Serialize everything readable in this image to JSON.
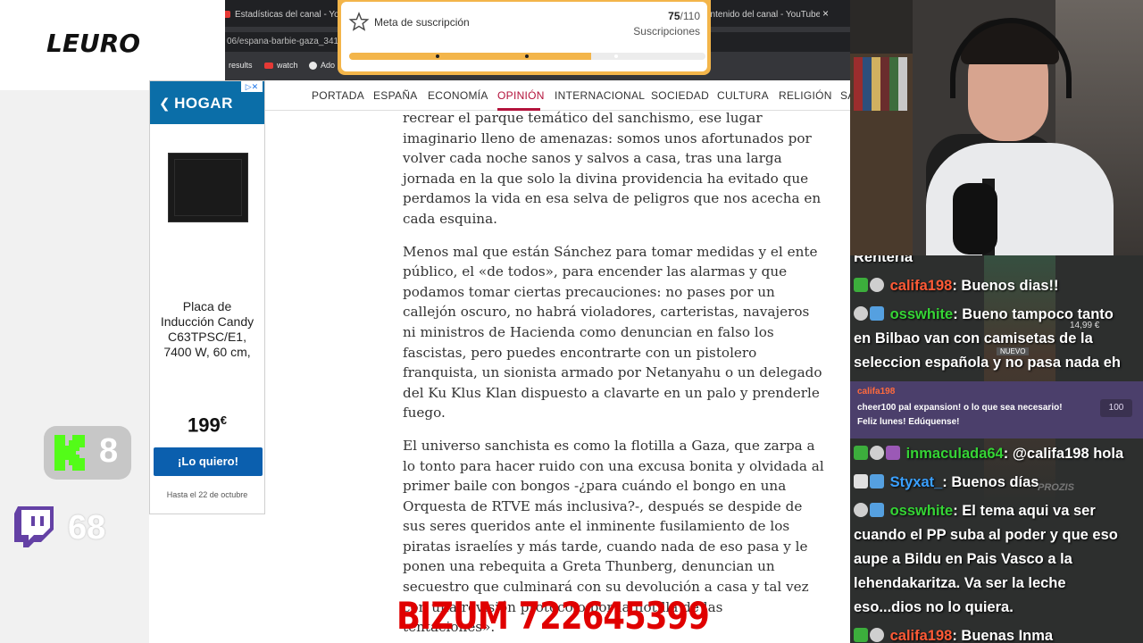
{
  "browser": {
    "tabs": [
      {
        "label": "Estadísticas del canal - YouTub"
      },
      {
        "label": "ontenido del canal - YouTube"
      }
    ],
    "tab_close": "×",
    "address_fragment": "06/espana-barbie-gaza_341",
    "bookmarks": [
      {
        "label": "results",
        "icon": "google-icon"
      },
      {
        "label": "watch",
        "icon": "youtube-icon"
      },
      {
        "label": "Ado",
        "icon": "bookmark-icon"
      }
    ]
  },
  "overlay": {
    "logo": "LEURO",
    "subscription_goal": {
      "title": "Meta de suscripción",
      "current": "75",
      "target": "/110",
      "unit": "Suscripciones",
      "progress_fraction": 0.68,
      "color": "#f3b54a"
    },
    "kick": {
      "count": "8",
      "color": "#53fc18"
    },
    "twitch": {
      "count": "68",
      "color": "#6441a5"
    },
    "bizum": "BIZUM 722645399"
  },
  "ad": {
    "brand": "HOGAR",
    "brand_mark": "❮",
    "adchoices": "▷✕",
    "product_name": "Placa de Inducción Candy C63TPSC/E1, 7400 W, 60 cm,",
    "price": "199",
    "currency": "€",
    "cta": "¡Lo quiero!",
    "valid_until": "Hasta el 22 de octubre",
    "accent": "#0b5fae"
  },
  "nav": {
    "items": [
      "PORTADA",
      "ESPAÑA",
      "ECONOMÍA",
      "OPINIÓN",
      "INTERNACIONAL",
      "SOCIEDAD",
      "CULTURA",
      "RELIGIÓN",
      "SA"
    ],
    "active": "OPINIÓN",
    "accent": "#b3123b"
  },
  "article": {
    "paragraphs": [
      [
        "recrear el parque temático del sanchismo, ese lugar",
        "imaginario lleno de amenazas: somos unos afortunados por",
        "volver cada noche sanos y salvos a casa, tras una larga",
        "jornada en la que solo la divina providencia ha evitado que",
        "perdamos la vida en esa selva de peligros que nos acecha en",
        "cada esquina."
      ],
      [
        "Menos mal que están Sánchez para tomar medidas y el ente",
        "público, el «de todos», para encender las alarmas y que",
        "podamos tomar ciertas precauciones: no pases por un",
        "callejón oscuro, no habrá violadores, carteristas, navajeros",
        "ni ministros de Hacienda como denuncian en falso los",
        "fascistas, pero puedes encontrarte con un pistolero",
        "franquista, un sionista armado por Netanyahu o un delegado",
        "del Ku Klus Klan dispuesto a clavarte en un palo y prenderle",
        "fuego."
      ],
      [
        "El universo sanchista es como la flotilla a Gaza, que zarpa a",
        "lo tonto para hacer ruido con una excusa bonita y olvidada al",
        "primer baile con bongos -¿para cuándo el bongo en una",
        "Orquesta de RTVE más inclusiva?-, después se despide de",
        "sus seres queridos ante el inminente fusilamiento de los",
        "piratas israelíes y más tarde, cuando nada de eso pasa y le",
        "ponen una rebequita a Greta Thunberg, denuncian un",
        "secuestro que culminará con su devolución a casa y tal vez",
        "con una revisión protocolo por la flotilla de las",
        "tentaciones»."
      ]
    ]
  },
  "chat": {
    "partial_top": "Rentería",
    "messages": [
      {
        "user": "califa198",
        "user_color": "#ff5a36",
        "badges": [
          "green",
          "grey"
        ],
        "text": ": Buenos dias!!"
      },
      {
        "user": "osswhite",
        "user_color": "#35d435",
        "badges": [
          "grey",
          "blue"
        ],
        "text": ": Bueno tampoco tanto",
        "cont": [
          "en Bilbao van con camisetas de la",
          "seleccion española y no pasa nada eh"
        ]
      },
      {
        "user": "inmaculada64",
        "user_color": "#35d435",
        "badges": [
          "green",
          "grey",
          "purple"
        ],
        "text": ": @califa198 hola"
      },
      {
        "user": "Styxat_",
        "user_color": "#3aa0ff",
        "badges": [
          "white",
          "blue"
        ],
        "text": ": Buenos días"
      },
      {
        "user": "osswhite",
        "user_color": "#35d435",
        "badges": [
          "grey",
          "blue"
        ],
        "text": ": El tema aqui va ser",
        "cont": [
          "cuando el PP suba al poder y que eso",
          "aupe a Bildu en Pais Vasco a la",
          "lehendakaritza. Va ser la leche",
          "eso...dios no lo quiera."
        ]
      },
      {
        "user": "califa198",
        "user_color": "#ff5a36",
        "badges": [
          "green",
          "grey"
        ],
        "text": ": Buenas Inma"
      }
    ],
    "cheer": {
      "user": "califa198",
      "text": "cheer100 pal expansion! o lo que sea necesario! Feliz lunes! Edúquense!",
      "amount": "100"
    },
    "promo": {
      "price": "14,99 €",
      "badge": "NUEVO",
      "brand": "PROZIS"
    }
  }
}
